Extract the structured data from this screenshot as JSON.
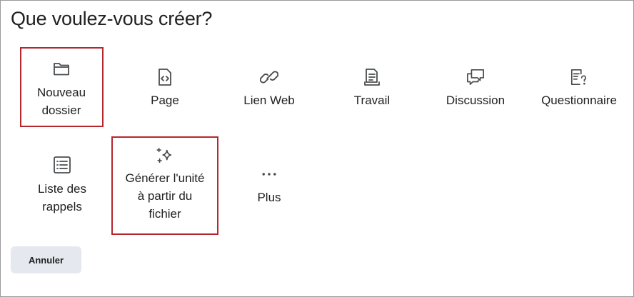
{
  "dialog": {
    "title": "Que voulez-vous créer?"
  },
  "options": {
    "new_folder": {
      "line1": "Nouveau",
      "line2": "dossier",
      "icon": "folder-icon"
    },
    "page": {
      "label": "Page",
      "icon": "code-page-icon"
    },
    "web_link": {
      "label": "Lien Web",
      "icon": "link-icon"
    },
    "assignment": {
      "label": "Travail",
      "icon": "assignment-icon"
    },
    "discussion": {
      "label": "Discussion",
      "icon": "discussion-icon"
    },
    "quiz": {
      "label": "Questionnaire",
      "icon": "quiz-icon"
    },
    "checklist": {
      "line1": "Liste des",
      "line2": "rappels",
      "icon": "checklist-icon"
    },
    "generate_unit": {
      "line1": "Générer l'unité",
      "line2": "à partir du",
      "line3": "fichier",
      "icon": "sparkle-icon"
    },
    "more": {
      "label": "Plus",
      "icon": "more-dots-icon"
    }
  },
  "footer": {
    "cancel_label": "Annuler"
  },
  "colors": {
    "highlight_border": "#b5272d",
    "cancel_bg": "#e5e9ef",
    "text": "#202122"
  }
}
